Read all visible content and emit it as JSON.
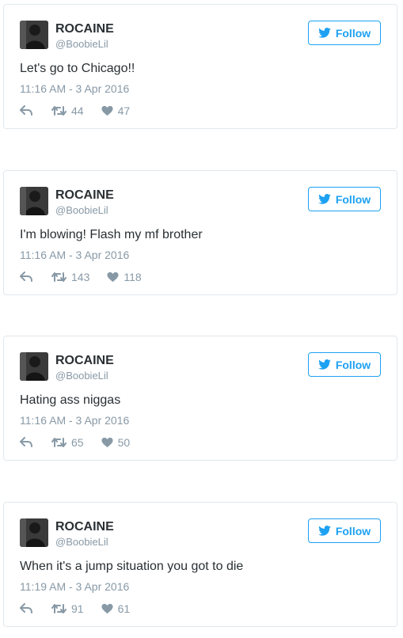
{
  "tweets": [
    {
      "name": "ROCAINE",
      "handle": "@BoobieLil",
      "follow_label": "Follow",
      "text": "Let's go to Chicago!!",
      "time": "11:16 AM - 3 Apr 2016",
      "retweets": "44",
      "likes": "47"
    },
    {
      "name": "ROCAINE",
      "handle": "@BoobieLil",
      "follow_label": "Follow",
      "text": "I'm blowing! Flash my mf brother",
      "time": "11:16 AM - 3 Apr 2016",
      "retweets": "143",
      "likes": "118"
    },
    {
      "name": "ROCAINE",
      "handle": "@BoobieLil",
      "follow_label": "Follow",
      "text": "Hating ass niggas",
      "time": "11:16 AM - 3 Apr 2016",
      "retweets": "65",
      "likes": "50"
    },
    {
      "name": "ROCAINE",
      "handle": "@BoobieLil",
      "follow_label": "Follow",
      "text": "When it's a jump situation you got to die",
      "time": "11:19 AM - 3 Apr 2016",
      "retweets": "91",
      "likes": "61"
    }
  ],
  "icons": {
    "follow": "twitter-bird-icon",
    "reply": "reply-icon",
    "retweet": "retweet-icon",
    "like": "heart-icon"
  },
  "colors": {
    "accent": "#1da1f2",
    "text": "#292f33",
    "muted": "#8899a6",
    "border": "#e1e8ed"
  }
}
